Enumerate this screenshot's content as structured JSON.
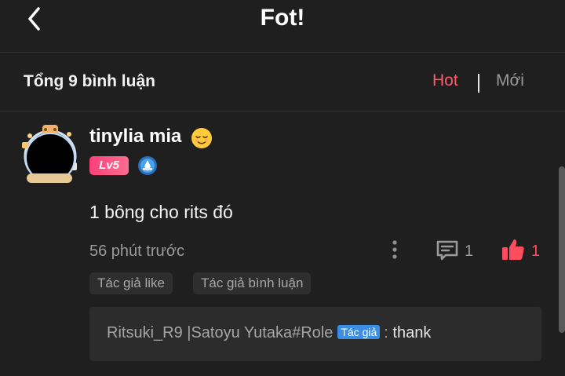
{
  "header": {
    "title": "Fot!"
  },
  "sort_bar": {
    "total": "Tổng 9 bình luận",
    "hot_label": "Hot",
    "new_label": "Mới",
    "active": "Hot",
    "active_color": "#ff5a6e"
  },
  "comment": {
    "username": "tinylia mia",
    "username_emoji": "relieved-face-emoji",
    "level_badge": "Lv5",
    "content": "1 bông cho rits đó",
    "time": "56 phút trước",
    "reply_count": "1",
    "like_count": "1",
    "tags": [
      "Tác giả like",
      "Tác giả bình luận"
    ],
    "reply": {
      "author": "Ritsuki_R9 |Satoyu Yutaka#Role",
      "author_tag": "Tác giả",
      "separator": ":",
      "message": "thank"
    }
  },
  "colors": {
    "background": "#1f1f1f",
    "accent": "#ff5a6e",
    "like": "#ff4d5e",
    "author_tag": "#3b8ee8"
  }
}
